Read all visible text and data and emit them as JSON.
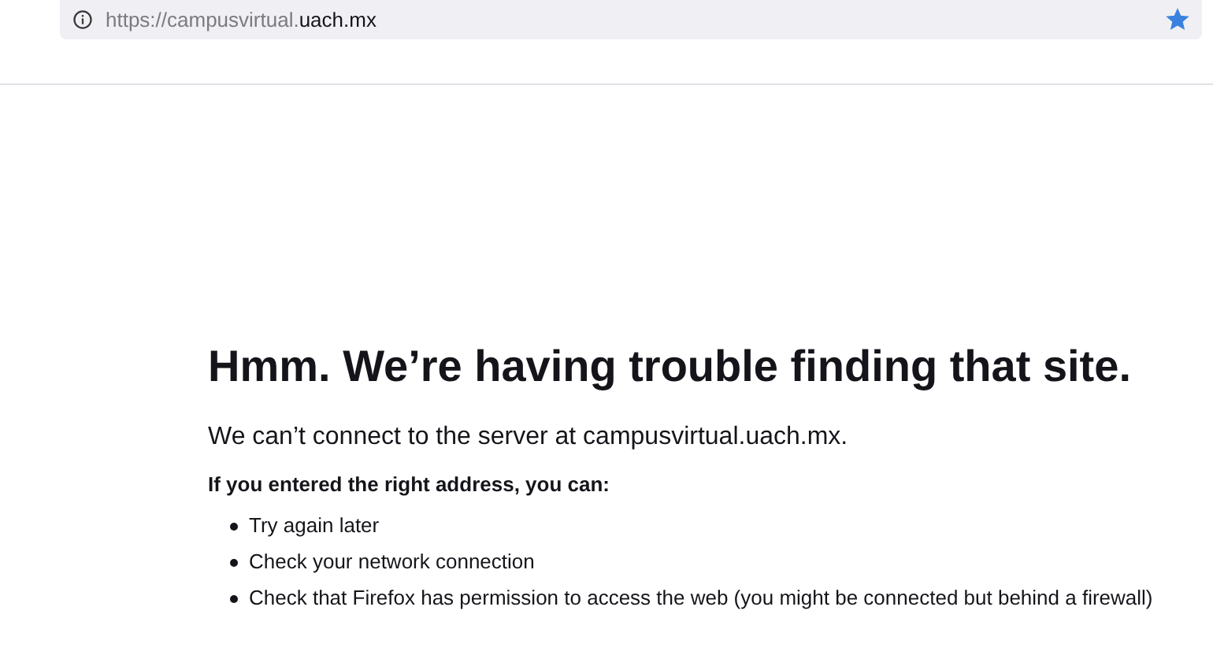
{
  "address_bar": {
    "url_prefix": "https://campusvirtual.",
    "url_domain": "uach.mx",
    "bookmarked": true
  },
  "error": {
    "title": "Hmm. We’re having trouble finding that site.",
    "message": "We can’t connect to the server at campusvirtual.uach.mx.",
    "suggestions_heading": "If you entered the right address, you can:",
    "suggestions": [
      "Try again later",
      "Check your network connection",
      "Check that Firefox has permission to access the web (you might be connected but behind a firewall)"
    ]
  }
}
